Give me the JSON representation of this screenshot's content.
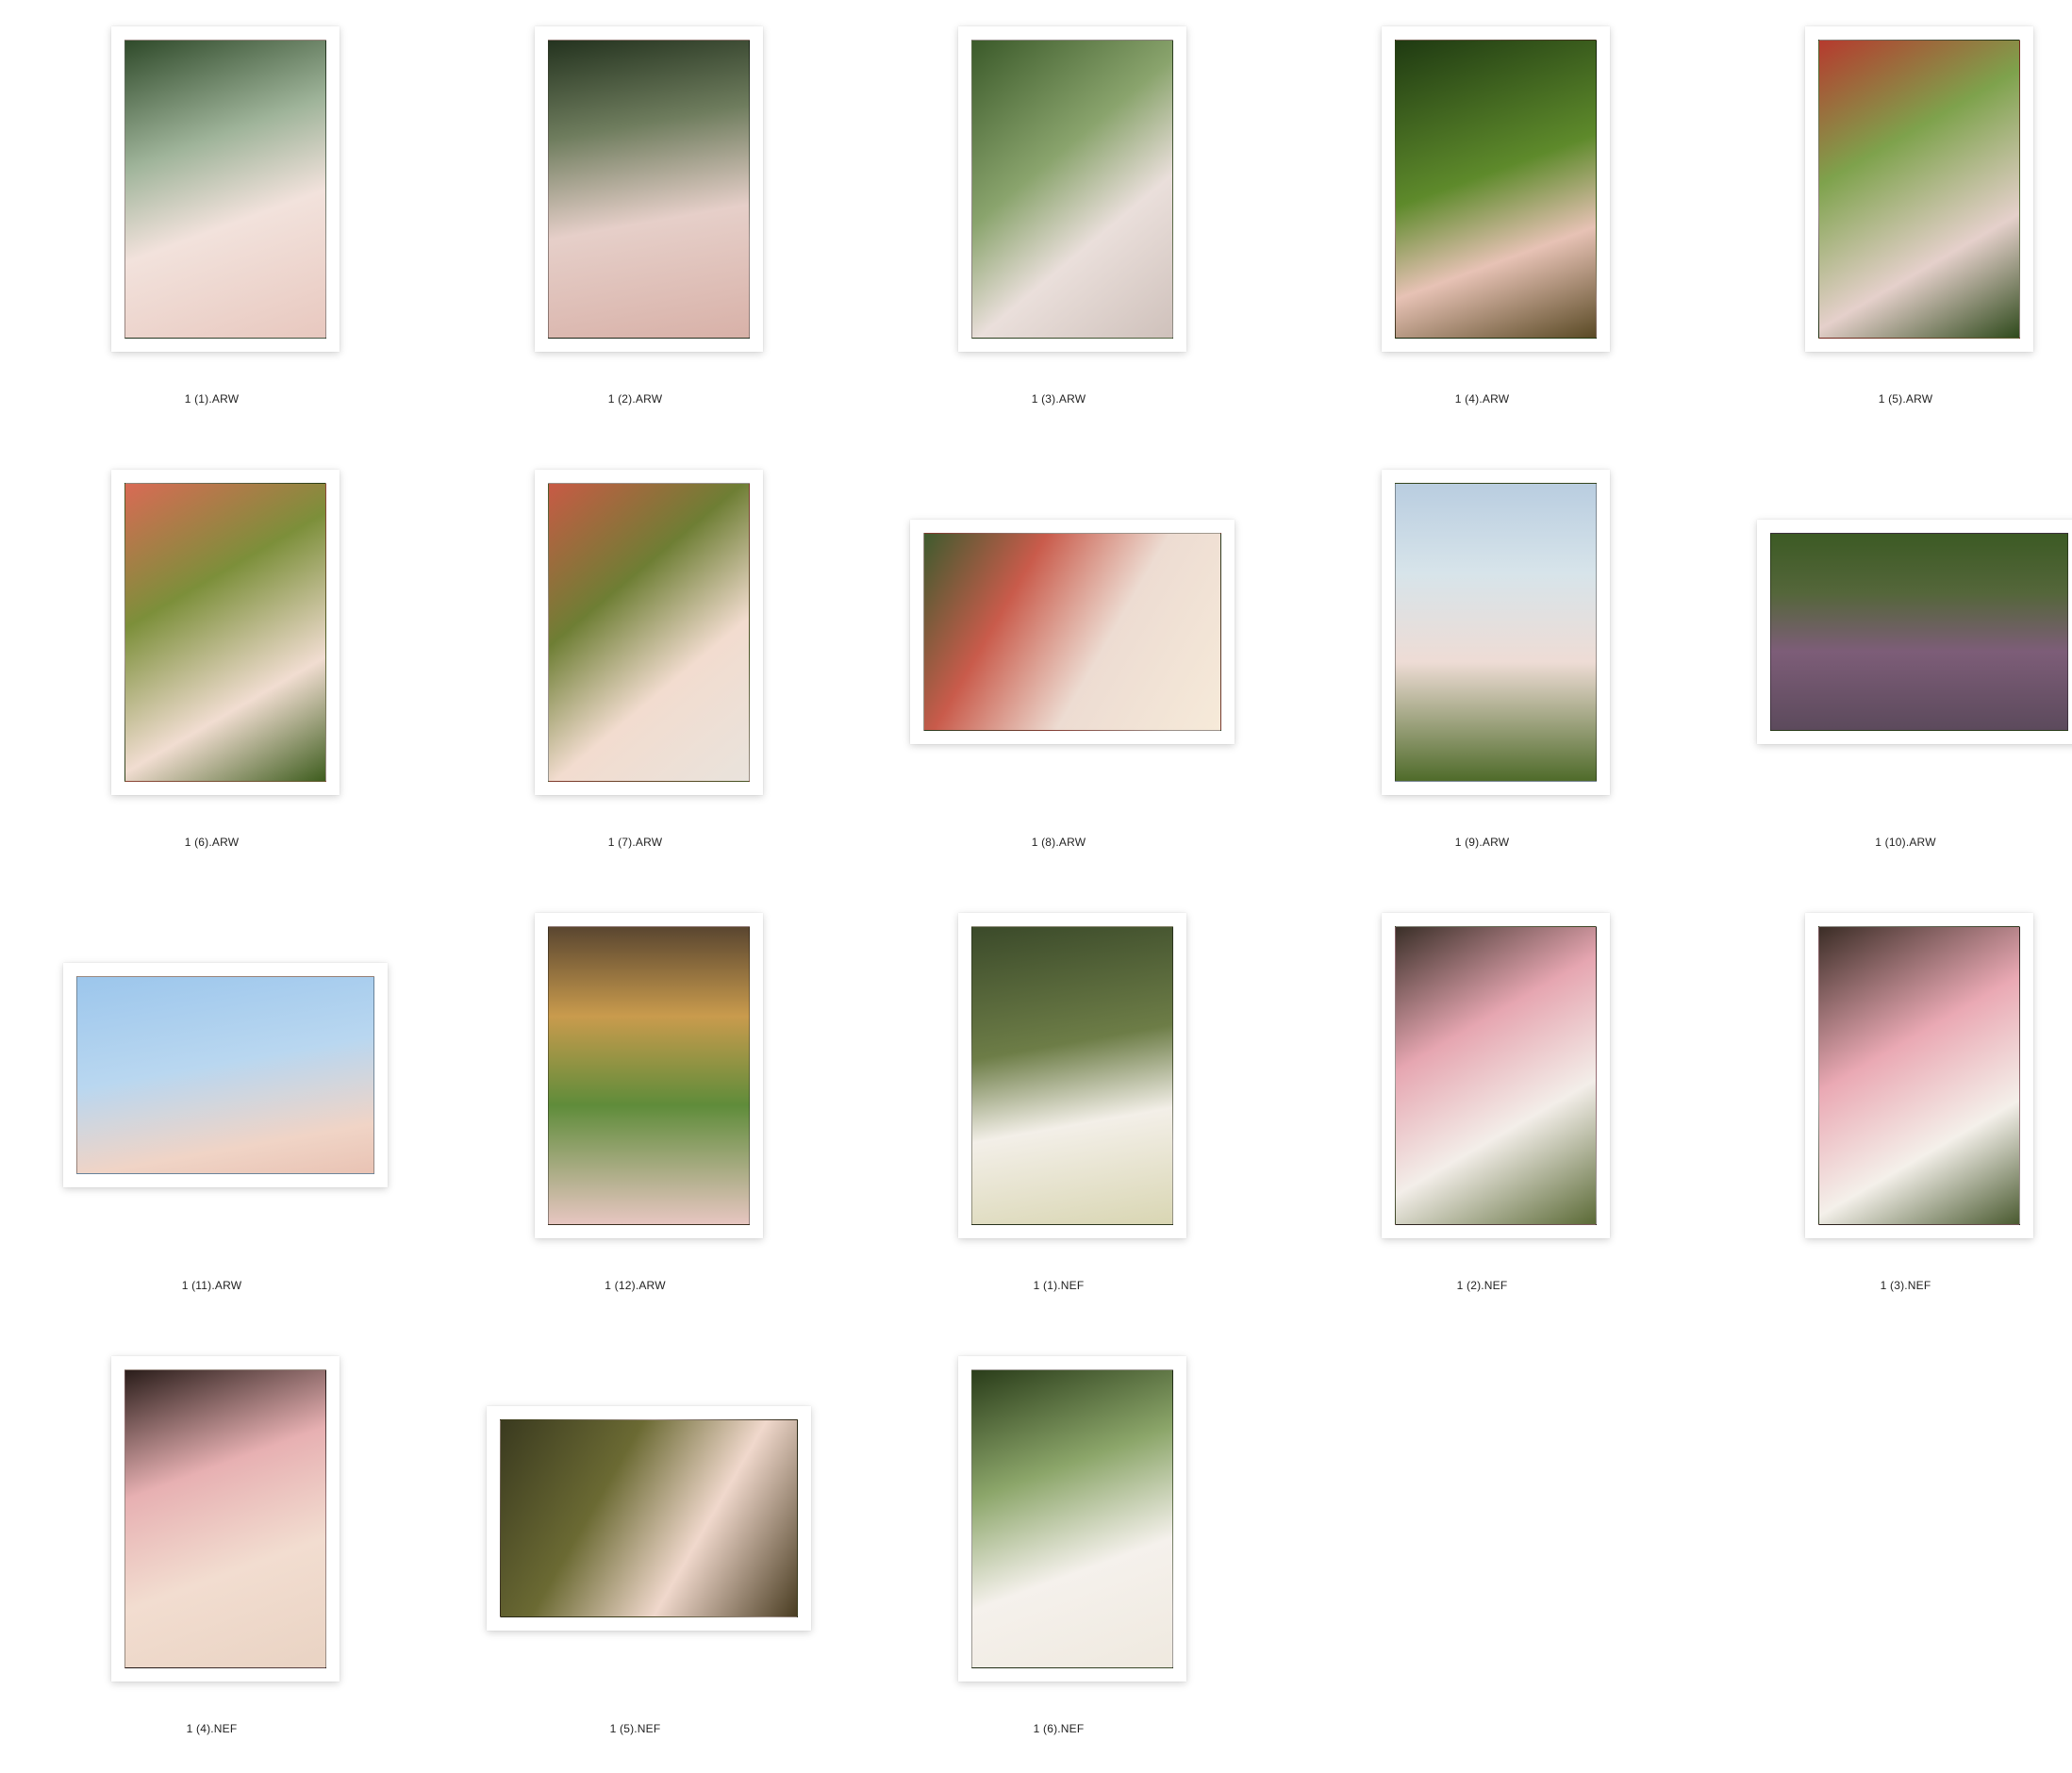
{
  "photos": [
    {
      "filename": "1 (1).ARW",
      "orientation": "portrait"
    },
    {
      "filename": "1 (2).ARW",
      "orientation": "portrait"
    },
    {
      "filename": "1 (3).ARW",
      "orientation": "portrait"
    },
    {
      "filename": "1 (4).ARW",
      "orientation": "portrait"
    },
    {
      "filename": "1 (5).ARW",
      "orientation": "portrait"
    },
    {
      "filename": "1 (6).ARW",
      "orientation": "portrait"
    },
    {
      "filename": "1 (7).ARW",
      "orientation": "portrait"
    },
    {
      "filename": "1 (8).ARW",
      "orientation": "landscape"
    },
    {
      "filename": "1 (9).ARW",
      "orientation": "portrait"
    },
    {
      "filename": "1 (10).ARW",
      "orientation": "landscape"
    },
    {
      "filename": "1 (11).ARW",
      "orientation": "landscape"
    },
    {
      "filename": "1 (12).ARW",
      "orientation": "portrait"
    },
    {
      "filename": "1 (1).NEF",
      "orientation": "portrait"
    },
    {
      "filename": "1 (2).NEF",
      "orientation": "portrait"
    },
    {
      "filename": "1 (3).NEF",
      "orientation": "portrait"
    },
    {
      "filename": "1 (4).NEF",
      "orientation": "portrait"
    },
    {
      "filename": "1 (5).NEF",
      "orientation": "landscape"
    },
    {
      "filename": "1 (6).NEF",
      "orientation": "portrait"
    }
  ]
}
